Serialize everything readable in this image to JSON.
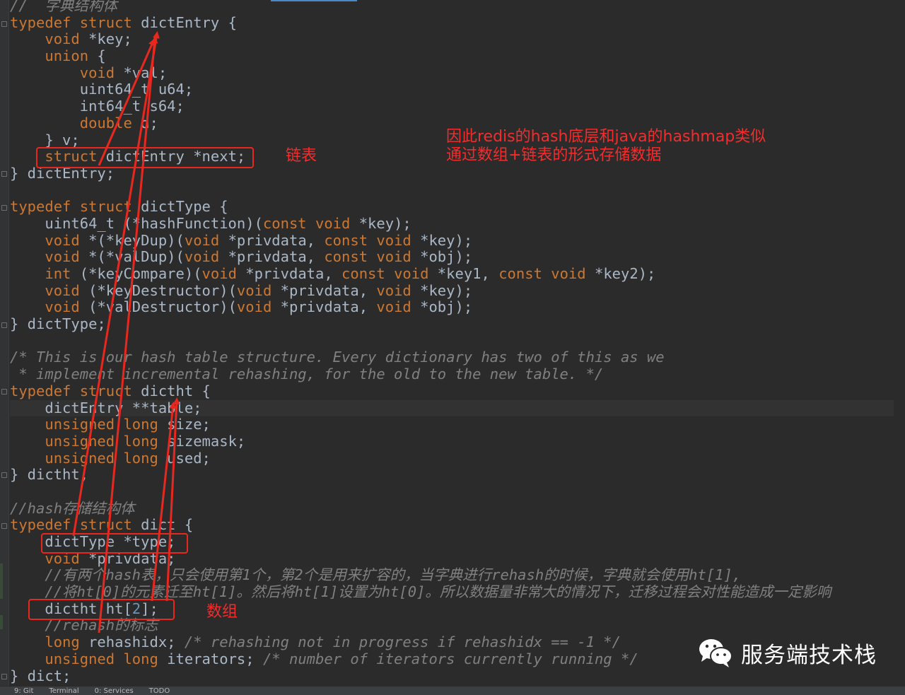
{
  "editor": {
    "lines": [
      {
        "tokens": [
          {
            "t": "//  字典结构体",
            "c": "cm"
          }
        ]
      },
      {
        "tokens": [
          {
            "t": "typedef",
            "c": "kw"
          },
          {
            "t": " "
          },
          {
            "t": "struct",
            "c": "kw"
          },
          {
            "t": " dictEntry {"
          }
        ]
      },
      {
        "tokens": [
          {
            "t": "    "
          },
          {
            "t": "void",
            "c": "kw"
          },
          {
            "t": " *key;"
          }
        ]
      },
      {
        "tokens": [
          {
            "t": "    "
          },
          {
            "t": "union",
            "c": "kw"
          },
          {
            "t": " {"
          }
        ]
      },
      {
        "tokens": [
          {
            "t": "        "
          },
          {
            "t": "void",
            "c": "kw"
          },
          {
            "t": " *val;"
          }
        ]
      },
      {
        "tokens": [
          {
            "t": "        uint64_t u64;"
          }
        ]
      },
      {
        "tokens": [
          {
            "t": "        int64_t s64;"
          }
        ]
      },
      {
        "tokens": [
          {
            "t": "        "
          },
          {
            "t": "double",
            "c": "kw"
          },
          {
            "t": " d;"
          }
        ]
      },
      {
        "tokens": [
          {
            "t": "    } v;"
          }
        ]
      },
      {
        "tokens": [
          {
            "t": "    "
          },
          {
            "t": "struct",
            "c": "kw"
          },
          {
            "t": " dictEntry *next;"
          }
        ]
      },
      {
        "tokens": [
          {
            "t": "} dictEntry;"
          }
        ]
      },
      {
        "tokens": []
      },
      {
        "tokens": [
          {
            "t": "typedef",
            "c": "kw"
          },
          {
            "t": " "
          },
          {
            "t": "struct",
            "c": "kw"
          },
          {
            "t": " dictType {"
          }
        ]
      },
      {
        "tokens": [
          {
            "t": "    uint64_t (*hashFunction)("
          },
          {
            "t": "const",
            "c": "kw"
          },
          {
            "t": " "
          },
          {
            "t": "void",
            "c": "kw"
          },
          {
            "t": " *key);"
          }
        ]
      },
      {
        "tokens": [
          {
            "t": "    "
          },
          {
            "t": "void",
            "c": "kw"
          },
          {
            "t": " *(*keyDup)("
          },
          {
            "t": "void",
            "c": "kw"
          },
          {
            "t": " *privdata, "
          },
          {
            "t": "const",
            "c": "kw"
          },
          {
            "t": " "
          },
          {
            "t": "void",
            "c": "kw"
          },
          {
            "t": " *key);"
          }
        ]
      },
      {
        "tokens": [
          {
            "t": "    "
          },
          {
            "t": "void",
            "c": "kw"
          },
          {
            "t": " *(*valDup)("
          },
          {
            "t": "void",
            "c": "kw"
          },
          {
            "t": " *privdata, "
          },
          {
            "t": "const",
            "c": "kw"
          },
          {
            "t": " "
          },
          {
            "t": "void",
            "c": "kw"
          },
          {
            "t": " *obj);"
          }
        ]
      },
      {
        "tokens": [
          {
            "t": "    "
          },
          {
            "t": "int",
            "c": "kw"
          },
          {
            "t": " (*keyCompare)("
          },
          {
            "t": "void",
            "c": "kw"
          },
          {
            "t": " *privdata, "
          },
          {
            "t": "const",
            "c": "kw"
          },
          {
            "t": " "
          },
          {
            "t": "void",
            "c": "kw"
          },
          {
            "t": " *key1, "
          },
          {
            "t": "const",
            "c": "kw"
          },
          {
            "t": " "
          },
          {
            "t": "void",
            "c": "kw"
          },
          {
            "t": " *key2);"
          }
        ]
      },
      {
        "tokens": [
          {
            "t": "    "
          },
          {
            "t": "void",
            "c": "kw"
          },
          {
            "t": " (*keyDestructor)("
          },
          {
            "t": "void",
            "c": "kw"
          },
          {
            "t": " *privdata, "
          },
          {
            "t": "void",
            "c": "kw"
          },
          {
            "t": " *key);"
          }
        ]
      },
      {
        "tokens": [
          {
            "t": "    "
          },
          {
            "t": "void",
            "c": "kw"
          },
          {
            "t": " (*valDestructor)("
          },
          {
            "t": "void",
            "c": "kw"
          },
          {
            "t": " *privdata, "
          },
          {
            "t": "void",
            "c": "kw"
          },
          {
            "t": " *obj);"
          }
        ]
      },
      {
        "tokens": [
          {
            "t": "} dictType;"
          }
        ]
      },
      {
        "tokens": []
      },
      {
        "tokens": [
          {
            "t": "/* This is our hash table structure. Every dictionary has two of this as we",
            "c": "cm"
          }
        ]
      },
      {
        "tokens": [
          {
            "t": " * implement incremental rehashing, for the old to the new table. */",
            "c": "cm"
          }
        ]
      },
      {
        "tokens": [
          {
            "t": "typedef",
            "c": "kw"
          },
          {
            "t": " "
          },
          {
            "t": "struct",
            "c": "kw"
          },
          {
            "t": " dictht {"
          }
        ]
      },
      {
        "tokens": [
          {
            "t": "    dictEntry **table;"
          }
        ],
        "hl": true
      },
      {
        "tokens": [
          {
            "t": "    "
          },
          {
            "t": "unsigned",
            "c": "kw"
          },
          {
            "t": " "
          },
          {
            "t": "long",
            "c": "kw"
          },
          {
            "t": " size;"
          }
        ]
      },
      {
        "tokens": [
          {
            "t": "    "
          },
          {
            "t": "unsigned",
            "c": "kw"
          },
          {
            "t": " "
          },
          {
            "t": "long",
            "c": "kw"
          },
          {
            "t": " sizemask;"
          }
        ]
      },
      {
        "tokens": [
          {
            "t": "    "
          },
          {
            "t": "unsigned",
            "c": "kw"
          },
          {
            "t": " "
          },
          {
            "t": "long",
            "c": "kw"
          },
          {
            "t": " used;"
          }
        ]
      },
      {
        "tokens": [
          {
            "t": "} dictht;"
          }
        ]
      },
      {
        "tokens": []
      },
      {
        "tokens": [
          {
            "t": "//hash存储结构体",
            "c": "cm"
          }
        ]
      },
      {
        "tokens": [
          {
            "t": "typedef",
            "c": "kw"
          },
          {
            "t": " "
          },
          {
            "t": "struct",
            "c": "kw"
          },
          {
            "t": " dict {"
          }
        ]
      },
      {
        "tokens": [
          {
            "t": "    dictType *type;"
          }
        ]
      },
      {
        "tokens": [
          {
            "t": "    "
          },
          {
            "t": "void",
            "c": "kw"
          },
          {
            "t": " *privdata;"
          }
        ]
      },
      {
        "tokens": [
          {
            "t": "    //有两个hash表，只会使用第1个，第2个是用来扩容的，当字典进行rehash的时候，字典就会使用ht[1],",
            "c": "cm"
          }
        ]
      },
      {
        "tokens": [
          {
            "t": "    //将ht[0]的元素迁至ht[1]。然后将ht[1]设置为ht[0]。所以数据量非常大的情况下，迁移过程会对性能造成一定影响",
            "c": "cm"
          }
        ]
      },
      {
        "tokens": [
          {
            "t": "    dictht ht["
          },
          {
            "t": "2",
            "c": "num"
          },
          {
            "t": "];"
          }
        ]
      },
      {
        "tokens": [
          {
            "t": "    //rehash的标志",
            "c": "cm"
          }
        ]
      },
      {
        "tokens": [
          {
            "t": "    "
          },
          {
            "t": "long",
            "c": "kw"
          },
          {
            "t": " rehashidx; "
          },
          {
            "t": "/* rehashing not in progress if rehashidx == -1 */",
            "c": "cm"
          }
        ]
      },
      {
        "tokens": [
          {
            "t": "    "
          },
          {
            "t": "unsigned",
            "c": "kw"
          },
          {
            "t": " "
          },
          {
            "t": "long",
            "c": "kw"
          },
          {
            "t": " iterators; "
          },
          {
            "t": "/* number of iterators currently running */",
            "c": "cm"
          }
        ]
      },
      {
        "tokens": [
          {
            "t": "} dict;"
          }
        ]
      }
    ]
  },
  "annotations": {
    "linked_list_label": "链表",
    "array_label": "数组",
    "note_line1": "因此redis的hash底层和java的hashmap类似",
    "note_line2": "通过数组+链表的形式存储数据"
  },
  "status_bar": {
    "items": [
      "9: Git",
      "Terminal",
      "0: Services",
      "TODO"
    ]
  },
  "watermark": {
    "text": "服务端技术栈",
    "icon": "wechat-icon"
  },
  "colors": {
    "keyword": "#cc7832",
    "comment": "#808080",
    "number": "#6897bb",
    "text": "#a9b7c6",
    "annotation": "#f42c2c",
    "background": "#2b2b2b"
  }
}
